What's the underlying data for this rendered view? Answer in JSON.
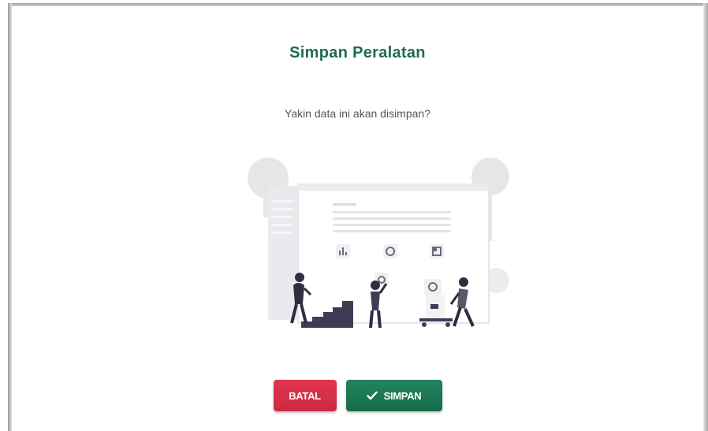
{
  "dialog": {
    "title": "Simpan Peralatan",
    "message": "Yakin data ini akan disimpan?",
    "illustration": "people-arranging-dashboard-illustration",
    "buttons": {
      "cancel_label": "BATAL",
      "save_label": "SIMPAN",
      "save_icon": "check-icon"
    }
  },
  "colors": {
    "title": "#1f6b4f",
    "cancel_button": "#d92f48",
    "save_button": "#1c7a56"
  }
}
